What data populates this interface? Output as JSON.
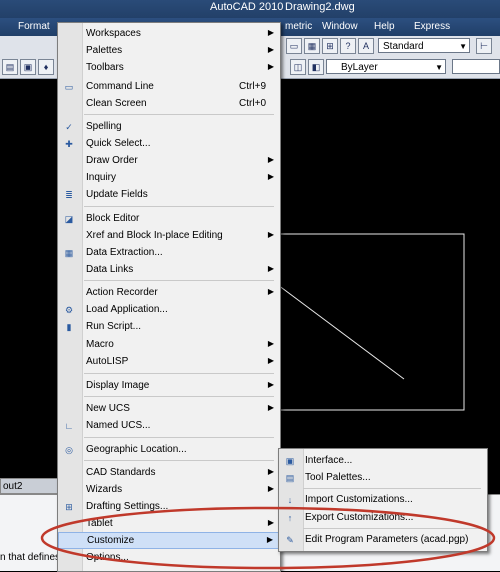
{
  "window": {
    "app_title": "AutoCAD 2010",
    "doc_title": "Drawing2.dwg",
    "accent": "#2a4b78"
  },
  "menubar": {
    "items": [
      "Format",
      "metric",
      "Window",
      "Help",
      "Express"
    ]
  },
  "toolbar": {
    "style_value": "Standard",
    "layer_value": "ByLayer"
  },
  "layout_tab": "out2",
  "status_text": "n that defines co",
  "tools_menu": {
    "items": [
      {
        "label": "Workspaces",
        "sub": true
      },
      {
        "label": "Palettes",
        "sub": true
      },
      {
        "label": "Toolbars",
        "sub": true
      },
      {
        "label": "Command Line",
        "shortcut": "Ctrl+9",
        "icon": "command-line-icon"
      },
      {
        "label": "Clean Screen",
        "shortcut": "Ctrl+0"
      },
      {
        "label": "Spelling",
        "icon": "spelling-icon"
      },
      {
        "label": "Quick Select...",
        "icon": "quick-select-icon"
      },
      {
        "label": "Draw Order",
        "sub": true
      },
      {
        "label": "Inquiry",
        "sub": true
      },
      {
        "label": "Update Fields",
        "icon": "update-fields-icon"
      },
      {
        "label": "Block Editor",
        "icon": "block-editor-icon"
      },
      {
        "label": "Xref and Block In-place Editing",
        "sub": true
      },
      {
        "label": "Data Extraction...",
        "icon": "data-extraction-icon"
      },
      {
        "label": "Data Links",
        "sub": true
      },
      {
        "label": "Action Recorder",
        "sub": true
      },
      {
        "label": "Load Application...",
        "icon": "load-application-icon"
      },
      {
        "label": "Run Script...",
        "icon": "run-script-icon"
      },
      {
        "label": "Macro",
        "sub": true
      },
      {
        "label": "AutoLISP",
        "sub": true
      },
      {
        "label": "Display Image",
        "sub": true
      },
      {
        "label": "New UCS",
        "sub": true
      },
      {
        "label": "Named UCS...",
        "icon": "named-ucs-icon"
      },
      {
        "label": "Geographic Location...",
        "icon": "globe-icon"
      },
      {
        "label": "CAD Standards",
        "sub": true
      },
      {
        "label": "Wizards",
        "sub": true
      },
      {
        "label": "Drafting Settings...",
        "icon": "drafting-settings-icon"
      },
      {
        "label": "Tablet",
        "sub": true
      },
      {
        "label": "Customize",
        "sub": true
      },
      {
        "label": "Options..."
      }
    ]
  },
  "customize_submenu": {
    "items": [
      {
        "label": "Interface...",
        "icon": "interface-icon"
      },
      {
        "label": "Tool Palettes...",
        "icon": "tool-palettes-icon"
      },
      {
        "label": "Import Customizations...",
        "icon": "import-icon"
      },
      {
        "label": "Export Customizations...",
        "icon": "export-icon"
      },
      {
        "label": "Edit Program Parameters (acad.pgp)",
        "icon": "edit-parameters-icon"
      }
    ]
  },
  "icons": {
    "submenu_arrow": "▶",
    "dropdown_arrow": "▼"
  },
  "colors": {
    "highlight_ellipse": "#c0392b",
    "menu_highlight": "#cfe0f7"
  }
}
